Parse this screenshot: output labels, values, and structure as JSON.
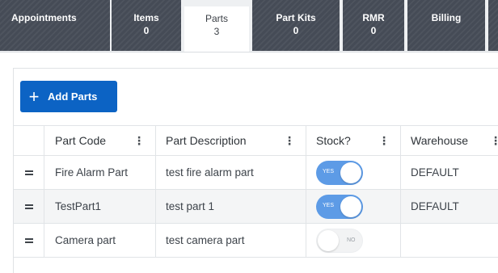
{
  "tabs": [
    {
      "label": "Appointments",
      "count": ""
    },
    {
      "label": "Items",
      "count": "0"
    },
    {
      "label": "Parts",
      "count": "3"
    },
    {
      "label": "Part Kits",
      "count": "0"
    },
    {
      "label": "RMR",
      "count": "0"
    },
    {
      "label": "Billing",
      "count": ""
    }
  ],
  "active_tab": "Parts",
  "toolbar": {
    "add_label": "Add Parts"
  },
  "table": {
    "columns": [
      "Part Code",
      "Part Description",
      "Stock?",
      "Warehouse"
    ],
    "rows": [
      {
        "code": "Fire Alarm Part",
        "description": "test fire alarm part",
        "stock": true,
        "stock_label": "YES",
        "warehouse": "DEFAULT"
      },
      {
        "code": "TestPart1",
        "description": "test part 1",
        "stock": true,
        "stock_label": "YES",
        "warehouse": "DEFAULT"
      },
      {
        "code": "Camera part",
        "description": "test camera part",
        "stock": false,
        "stock_label": "NO",
        "warehouse": ""
      }
    ]
  },
  "icons": {
    "add": "plus-icon",
    "menu": "kebab-menu-icon",
    "drag": "drag-handle-icon"
  },
  "colors": {
    "tab_bg": "#454b56",
    "accent": "#0c63c4",
    "toggle_on": "#5d9be6"
  }
}
